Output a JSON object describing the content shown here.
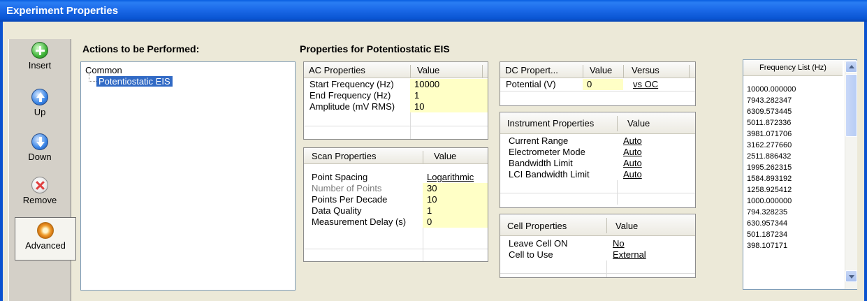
{
  "window": {
    "title": "Experiment Properties"
  },
  "toolbar": {
    "insert": "Insert",
    "up": "Up",
    "down": "Down",
    "remove": "Remove",
    "advanced": "Advanced"
  },
  "actions": {
    "heading": "Actions to be Performed:",
    "tree": [
      "Common",
      "Potentiostatic EIS"
    ]
  },
  "properties": {
    "heading": "Properties for Potentiostatic EIS"
  },
  "ac": {
    "col1": "AC Properties",
    "col2": "Value",
    "rows": [
      {
        "name": "Start Frequency (Hz)",
        "value": "10000"
      },
      {
        "name": "End Frequency (Hz)",
        "value": "1"
      },
      {
        "name": "Amplitude (mV RMS)",
        "value": "10"
      }
    ]
  },
  "scan": {
    "col1": "Scan Properties",
    "col2": "Value",
    "rows": [
      {
        "name": "Point Spacing",
        "value": "Logarithmic"
      },
      {
        "name": "Number of Points",
        "value": "30"
      },
      {
        "name": "Points Per Decade",
        "value": "10"
      },
      {
        "name": "Data Quality",
        "value": "1"
      },
      {
        "name": "Measurement Delay (s)",
        "value": "0"
      }
    ]
  },
  "dc": {
    "col1": "DC Propert...",
    "col2": "Value",
    "col3": "Versus",
    "rows": [
      {
        "name": "Potential (V)",
        "value": "0",
        "versus": "vs OC"
      }
    ]
  },
  "instrument": {
    "col1": "Instrument Properties",
    "col2": "Value",
    "rows": [
      {
        "name": "Current Range",
        "value": "Auto"
      },
      {
        "name": "Electrometer Mode",
        "value": "Auto"
      },
      {
        "name": "Bandwidth Limit",
        "value": "Auto"
      },
      {
        "name": "LCI Bandwidth Limit",
        "value": "Auto"
      }
    ]
  },
  "cell": {
    "col1": "Cell Properties",
    "col2": "Value",
    "rows": [
      {
        "name": "Leave Cell ON",
        "value": "No"
      },
      {
        "name": "Cell to Use",
        "value": "External"
      }
    ]
  },
  "frequency_list": {
    "header": "Frequency List (Hz)",
    "items": [
      "10000.000000",
      "7943.282347",
      "6309.573445",
      "5011.872336",
      "3981.071706",
      "3162.277660",
      "2511.886432",
      "1995.262315",
      "1584.893192",
      "1258.925412",
      "1000.000000",
      "794.328235",
      "630.957344",
      "501.187234",
      "398.107171"
    ]
  }
}
